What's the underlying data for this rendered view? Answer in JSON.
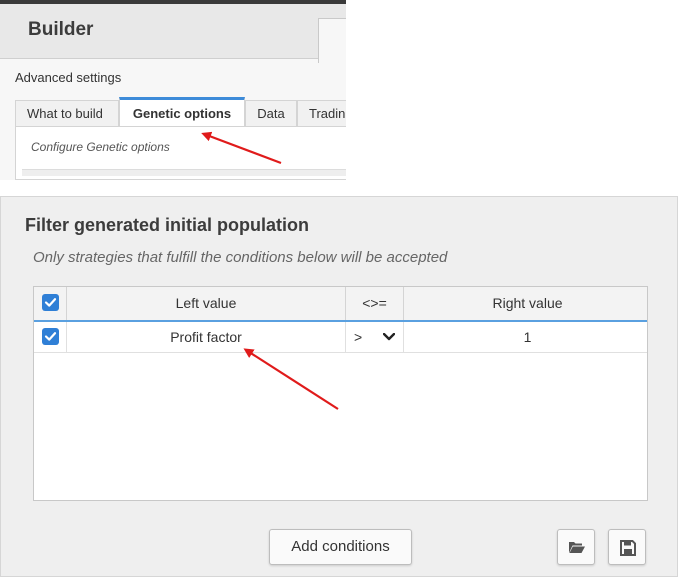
{
  "builder": {
    "title": "Builder",
    "advanced_settings_label": "Advanced settings",
    "tabs": [
      {
        "label": "What to build"
      },
      {
        "label": "Genetic options"
      },
      {
        "label": "Data"
      },
      {
        "label": "Tradin"
      }
    ],
    "active_tab": "Genetic options",
    "configure_label": "Configure Genetic options"
  },
  "filter": {
    "title": "Filter generated initial population",
    "subtitle": "Only strategies that fulfill the conditions below will be accepted",
    "columns": {
      "left_value": "Left value",
      "operator": "<>=",
      "right_value": "Right value"
    },
    "rows": [
      {
        "checked": true,
        "left_value": "Profit factor",
        "operator": ">",
        "right_value": "1",
        "remove": "✖.."
      }
    ],
    "add_conditions_label": "Add conditions"
  },
  "icons": {
    "checkbox": "check-icon",
    "operator_dropdown": "chevron-down-icon",
    "remove": "close-icon",
    "open": "folder-open-icon",
    "save": "floppy-disk-icon"
  },
  "colors": {
    "accent": "#2f7fd6",
    "tab_active_border": "#3d8bd9",
    "annotation_arrow": "#e01b1b"
  }
}
